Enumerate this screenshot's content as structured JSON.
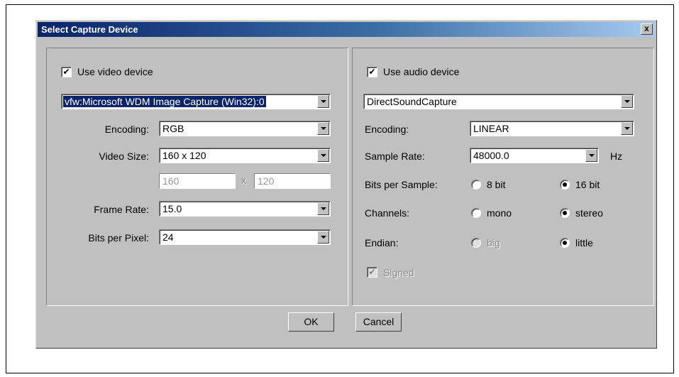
{
  "dialog": {
    "title": "Select Capture Device",
    "close_label": "x"
  },
  "video": {
    "use_label": "Use video device",
    "use_checked": true,
    "device": "vfw:Microsoft WDM Image Capture (Win32):0",
    "encoding_label": "Encoding:",
    "encoding_value": "RGB",
    "size_label": "Video Size:",
    "size_value": "160 x 120",
    "width_value": "160",
    "x_sep": "x",
    "height_value": "120",
    "framerate_label": "Frame Rate:",
    "framerate_value": "15.0",
    "bpp_label": "Bits per Pixel:",
    "bpp_value": "24"
  },
  "audio": {
    "use_label": "Use audio device",
    "use_checked": true,
    "device": "DirectSoundCapture",
    "encoding_label": "Encoding:",
    "encoding_value": "LINEAR",
    "rate_label": "Sample Rate:",
    "rate_value": "48000.0",
    "rate_unit": "Hz",
    "bits_label": "Bits per Sample:",
    "bits_opt1": "8 bit",
    "bits_opt2": "16 bit",
    "bits_selected": "16 bit",
    "channels_label": "Channels:",
    "channels_opt1": "mono",
    "channels_opt2": "stereo",
    "channels_selected": "stereo",
    "endian_label": "Endian:",
    "endian_opt1": "big",
    "endian_opt2": "little",
    "endian_selected": "little",
    "signed_label": "Signed",
    "signed_checked": true
  },
  "buttons": {
    "ok": "OK",
    "cancel": "Cancel"
  },
  "colors": {
    "titlebar_start": "#0a246a",
    "titlebar_end": "#a6caf0",
    "face": "#c0c0c0",
    "selection": "#0a246a"
  }
}
